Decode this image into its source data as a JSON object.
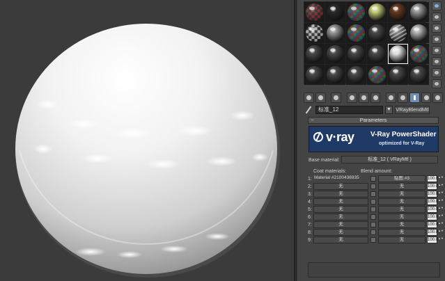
{
  "editor": {
    "material_name": "标准_12",
    "material_type": "VRayBlendMtl",
    "dropdown_arrow": "▼",
    "rollout_title": "Parameters",
    "rollout_toggle": "−"
  },
  "logo": {
    "brand": "v·ray",
    "title": "V-Ray PowerShader",
    "subtitle": "optimized for V-Ray"
  },
  "base": {
    "label": "Base material:",
    "value": "标准_12 ( VRayMtl )"
  },
  "coat_header": {
    "coat_label": "Coat materials:",
    "blend_label": "Blend amount:"
  },
  "coats": [
    {
      "index": "1:",
      "material": "Material #2100436935",
      "blend": "贴图 #3",
      "amount": "100.0"
    },
    {
      "index": "2:",
      "material": "无",
      "blend": "无",
      "amount": "100.0"
    },
    {
      "index": "3:",
      "material": "无",
      "blend": "无",
      "amount": "100.0"
    },
    {
      "index": "4:",
      "material": "无",
      "blend": "无",
      "amount": "100.0"
    },
    {
      "index": "5:",
      "material": "无",
      "blend": "无",
      "amount": "100.0"
    },
    {
      "index": "6:",
      "material": "无",
      "blend": "无",
      "amount": "100.0"
    },
    {
      "index": "7:",
      "material": "无",
      "blend": "无",
      "amount": "100.0"
    },
    {
      "index": "8:",
      "material": "无",
      "blend": "无",
      "amount": "100.0"
    },
    {
      "index": "9:",
      "material": "无",
      "blend": "无",
      "amount": "100.0"
    }
  ],
  "spinner_glyph": "▲▼",
  "slots": [
    "checker-red",
    "dark-shiny",
    "checker-color",
    "green-bright",
    "brown-shiny",
    "gray-shiny",
    "checker-bw",
    "gray-shiny",
    "checker-color",
    "gray-dark",
    "stripe",
    "gray-light",
    "gray-dark",
    "gray-dark",
    "gray-dark",
    "gray-dark",
    "white-active",
    "checker-color",
    "gray-dark",
    "gray-dark",
    "gray-dark",
    "checker-color",
    "gray-dark",
    "gray-dark"
  ],
  "active_slot": 16,
  "colors": {
    "panel_bg": "#444444",
    "viewport_bg": "#3b3b3b",
    "logo_bg": "#1f3a66",
    "accent_blue": "#6c8fb8"
  }
}
